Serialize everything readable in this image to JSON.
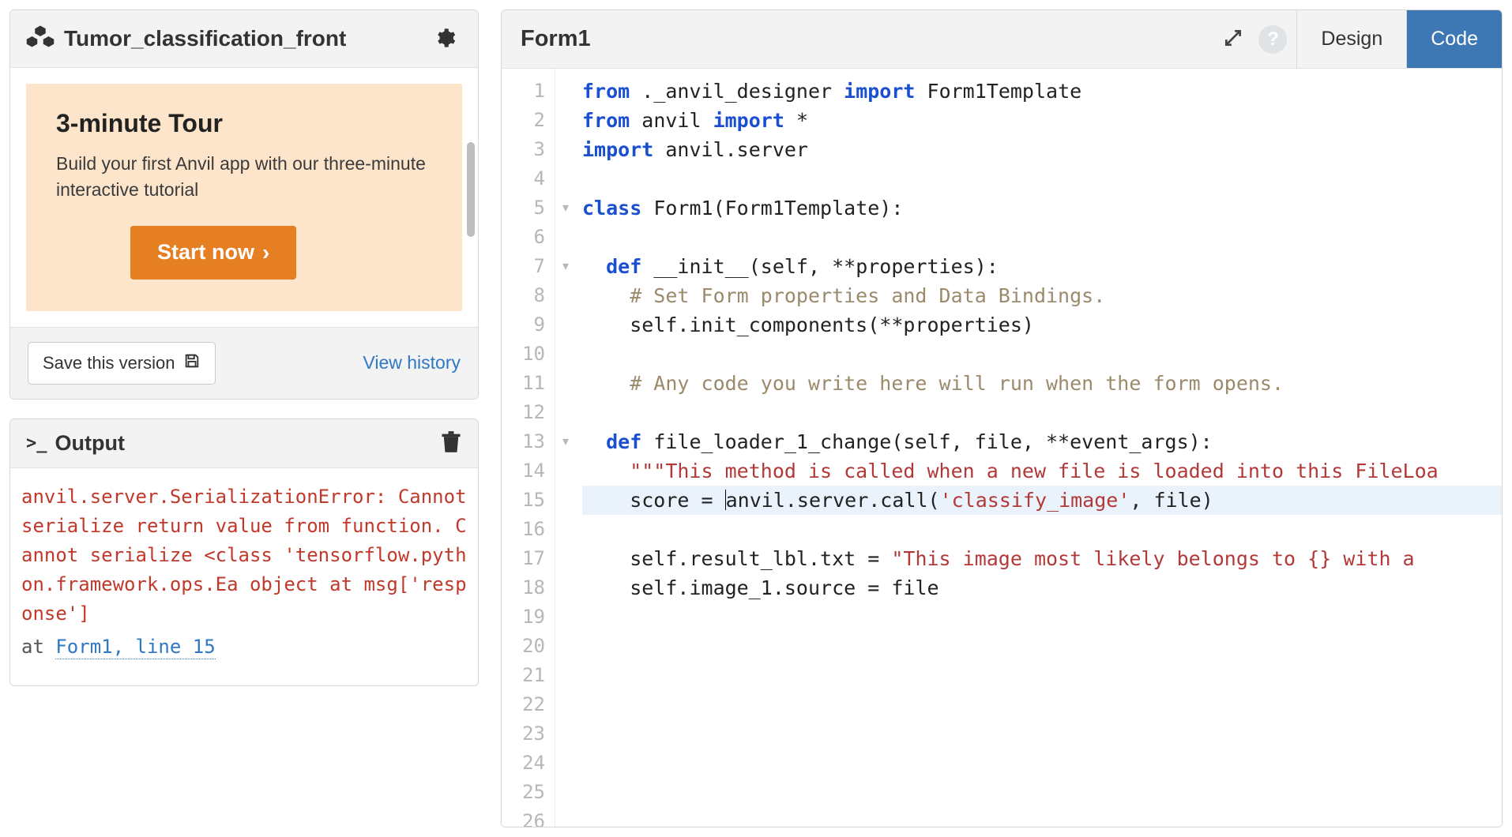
{
  "app": {
    "name": "Tumor_classification_front"
  },
  "tour": {
    "title": "3-minute Tour",
    "description": "Build your first Anvil app with our three-minute interactive tutorial",
    "button": "Start now"
  },
  "footer": {
    "save": "Save this version",
    "history": "View history"
  },
  "output": {
    "title": "Output",
    "error": "anvil.server.SerializationError: Cannot serialize return value from function. Cannot serialize <class 'tensorflow.python.framework.ops.Ea object at msg['response']",
    "at_prefix": "at ",
    "at_link": "Form1, line 15"
  },
  "editor": {
    "title": "Form1",
    "tabs": {
      "design": "Design",
      "code": "Code"
    },
    "line_count": 26,
    "fold_lines": [
      5,
      7,
      13
    ],
    "highlighted_line": 15,
    "code": {
      "l1_a": "from",
      "l1_b": " ._anvil_designer ",
      "l1_c": "import",
      "l1_d": " Form1Template",
      "l2_a": "from",
      "l2_b": " anvil ",
      "l2_c": "import",
      "l2_d": " *",
      "l3_a": "import",
      "l3_b": " anvil.server",
      "l5_a": "class",
      "l5_b": " Form1(Form1Template):",
      "l7_a": "  def",
      "l7_b": " __init__(self, **properties):",
      "l8": "    # Set Form properties and Data Bindings.",
      "l9": "    self.init_components(**properties)",
      "l11": "    # Any code you write here will run when the form opens.",
      "l13_a": "  def",
      "l13_b": " file_loader_1_change(self, file, **event_args):",
      "l14": "    \"\"\"This method is called when a new file is loaded into this FileLoa",
      "l15_a": "    score = ",
      "l15_b": "anvil.server.call(",
      "l15_c": "'classify_image'",
      "l15_d": ", file)",
      "l17_a": "    self.result_lbl.txt = ",
      "l17_b": "\"This image most likely belongs to {} with a ",
      "l18": "    self.image_1.source = file"
    }
  }
}
